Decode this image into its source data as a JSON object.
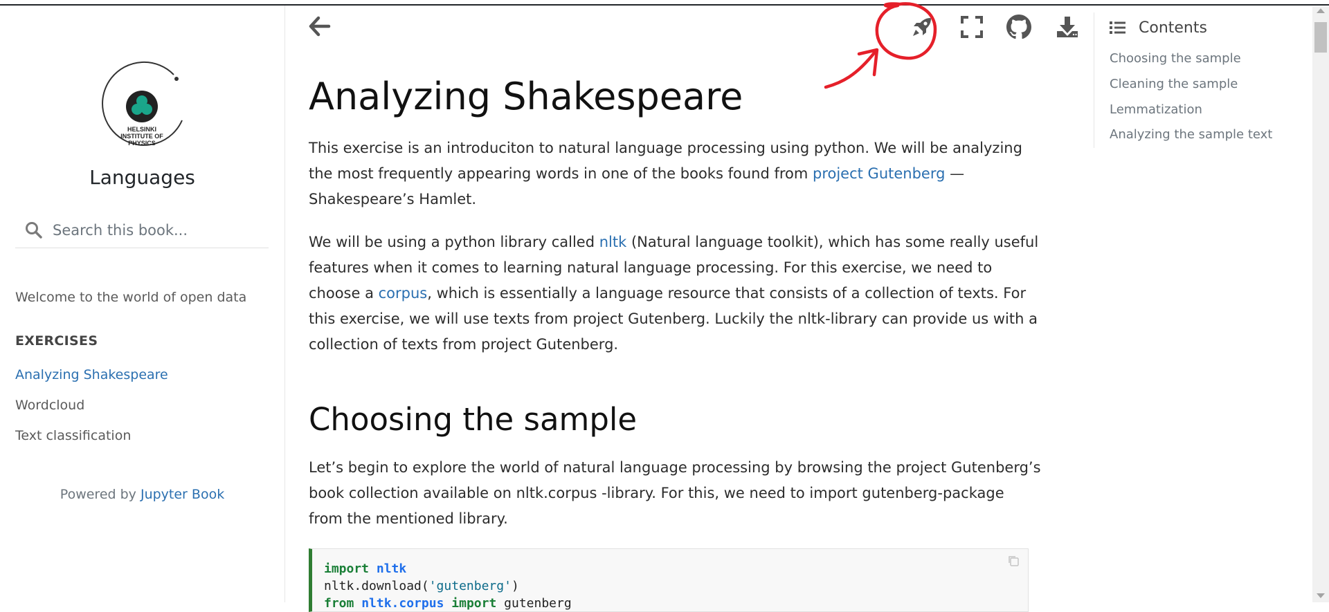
{
  "sidebar": {
    "logo_text": [
      "HELSINKI",
      "INSTITUTE OF",
      "PHYSICS"
    ],
    "title": "Languages",
    "search_placeholder": "Search this book...",
    "nav_welcome": "Welcome to the world of open data",
    "nav_caption": "EXERCISES",
    "nav_items": [
      "Analyzing Shakespeare",
      "Wordcloud",
      "Text classification"
    ],
    "powered_prefix": "Powered by ",
    "powered_link": "Jupyter Book"
  },
  "topbar": {
    "icons": [
      "arrow-left-icon",
      "rocket-icon",
      "fullscreen-icon",
      "github-icon",
      "download-icon"
    ],
    "annotation_color": "#e5202a"
  },
  "content": {
    "title": "Analyzing Shakespeare",
    "p1": {
      "a": "This exercise is an introduciton to natural language processing using python. We will be analyzing the most frequently appearing words in one of the books found from ",
      "link": "project Gutenberg",
      "b": " — Shakespeare’s Hamlet."
    },
    "p2": {
      "a": "We will be using a python library called ",
      "link1": "nltk",
      "b": " (Natural language toolkit), which has some really useful features when it comes to learning natural language processing. For this exercise, we need to choose a ",
      "link2": "corpus",
      "c": ", which is essentially a language resource that consists of a collection of texts. For this exercise, we will use texts from project Gutenberg. Luckily the nltk-library can provide us with a collection of texts from project Gutenberg."
    },
    "section_title": "Choosing the sample",
    "p3": "Let’s begin to explore the world of natural language processing by browsing the project Gutenberg’s book collection available on nltk.corpus -library. For this, we need to import gutenberg-package from the mentioned library.",
    "code": {
      "l1_kw": "import",
      "l1_mod": "nltk",
      "l2_a": "nltk.download(",
      "l2_str": "'gutenberg'",
      "l2_b": ")",
      "l3_kw": "from",
      "l3_mod": "nltk.corpus",
      "l3_kw2": "import",
      "l3_rest": "gutenberg"
    }
  },
  "toc": {
    "heading": "Contents",
    "items": [
      "Choosing the sample",
      "Cleaning the sample",
      "Lemmatization",
      "Analyzing the sample text"
    ]
  },
  "colors": {
    "link": "#2a6fb0",
    "code_border": "#2f7d32",
    "logo_teal": "#1aa58a"
  }
}
